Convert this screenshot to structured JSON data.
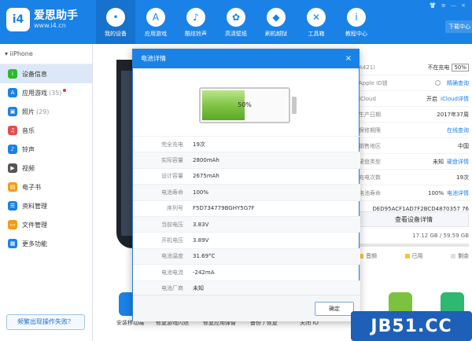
{
  "app": {
    "logo_mark": "i4",
    "title": "爱思助手",
    "url": "www.i4.cn"
  },
  "nav": [
    {
      "label": "我的设备",
      "icon": "apple-icon"
    },
    {
      "label": "应用游戏",
      "icon": "app-store-icon"
    },
    {
      "label": "酷炫铃声",
      "icon": "bell-icon"
    },
    {
      "label": "高清壁纸",
      "icon": "flower-icon"
    },
    {
      "label": "刷机越狱",
      "icon": "dropbox-icon"
    },
    {
      "label": "工具箱",
      "icon": "tools-icon"
    },
    {
      "label": "教程中心",
      "icon": "info-icon"
    }
  ],
  "download_label": "下载中心",
  "device_name": "iiPhone",
  "sidebar": {
    "items": [
      {
        "label": "设备信息",
        "color": "#2eb82e",
        "icon": "info-icon"
      },
      {
        "label": "应用游戏",
        "count": "(35)",
        "color": "#1a82e6",
        "icon": "app-store-icon"
      },
      {
        "label": "照片",
        "count": "(29)",
        "color": "#1a82e6",
        "icon": "photo-icon"
      },
      {
        "label": "音乐",
        "color": "#e84c4c",
        "icon": "music-icon"
      },
      {
        "label": "铃声",
        "color": "#1a82e6",
        "icon": "bell-icon"
      },
      {
        "label": "视频",
        "color": "#555555",
        "icon": "video-icon"
      },
      {
        "label": "电子书",
        "color": "#f39c12",
        "icon": "book-icon"
      },
      {
        "label": "资料管理",
        "color": "#1a82e6",
        "icon": "contacts-icon"
      },
      {
        "label": "文件管理",
        "color": "#f39c12",
        "icon": "folder-icon"
      },
      {
        "label": "更多功能",
        "color": "#1a82e6",
        "icon": "grid-icon"
      }
    ],
    "fix_button": "频繁出现操作失败？"
  },
  "info": {
    "rows": [
      {
        "k": "A421)",
        "v": "不在充电",
        "box": "50%"
      },
      {
        "k": "Apple ID锁",
        "v": "",
        "link": "精确查询",
        "radio": true
      },
      {
        "k": "iCloud",
        "v": "开启",
        "link": "iCloud详情"
      },
      {
        "k": "生产日期",
        "v": "2017年37周"
      },
      {
        "k": "保修期限",
        "v": "",
        "link": "在线查询"
      },
      {
        "k": "销售地区",
        "v": "中国"
      },
      {
        "k": "硬盘类型",
        "v": "未知",
        "link": "硬盘详情"
      },
      {
        "k": "充电次数",
        "v": "19次"
      },
      {
        "k": "电池寿命",
        "v": "100%",
        "link": "电池详情"
      },
      {
        "k": "",
        "v": "DED95ACF1AD7F2BCD4870357 76"
      }
    ],
    "view_button": "查看设备详情",
    "storage": "17.12 GB / 59.59 GB",
    "legend": [
      {
        "label": "音频",
        "color": "#f5c542"
      },
      {
        "label": "已用",
        "color": "#f5c542"
      },
      {
        "label": "剩余",
        "color": "#dddddd"
      }
    ]
  },
  "tools": [
    {
      "label": "安装移动端",
      "color": "#1a82e6"
    },
    {
      "label": "修复游戏闪退",
      "color": "#ffffff"
    },
    {
      "label": "修复应用弹窗",
      "color": "#ffffff"
    },
    {
      "label": "备份 / 恢复",
      "color": "#ffffff"
    },
    {
      "label": "关闭 iO",
      "color": "#ffffff"
    },
    {
      "label": "",
      "color": "#7cc23e"
    },
    {
      "label": "",
      "color": "#2eb872"
    }
  ],
  "modal": {
    "title": "电池详情",
    "close_glyph": "×",
    "battery_level": 0.5,
    "battery_text": "50%",
    "rows": [
      {
        "k": "完全充电",
        "v": "19次"
      },
      {
        "k": "实际容量",
        "v": "2800mAh"
      },
      {
        "k": "设计容量",
        "v": "2675mAh"
      },
      {
        "k": "电池寿命",
        "v": "100%"
      },
      {
        "k": "序列号",
        "v": "F5D734779BGHY5G7F"
      },
      {
        "k": "当前电压",
        "v": "3.83V"
      },
      {
        "k": "开机电压",
        "v": "3.89V"
      },
      {
        "k": "电池温度",
        "v": "31.69°C"
      },
      {
        "k": "电池电流",
        "v": "-242mA"
      },
      {
        "k": "电池厂商",
        "v": "未知"
      }
    ],
    "ok_label": "确定"
  },
  "watermark": "JB51.CC"
}
